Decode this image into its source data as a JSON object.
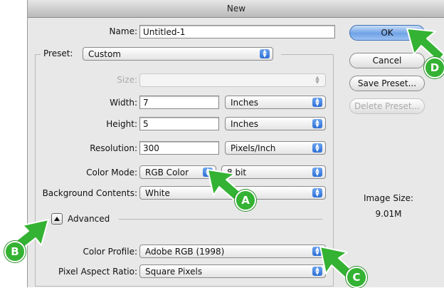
{
  "window": {
    "title": "New"
  },
  "form": {
    "name_label": "Name:",
    "name_value": "Untitled-1",
    "preset_label": "Preset:",
    "preset_value": "Custom",
    "size_label": "Size:",
    "width_label": "Width:",
    "width_value": "7",
    "width_unit": "Inches",
    "height_label": "Height:",
    "height_value": "5",
    "height_unit": "Inches",
    "resolution_label": "Resolution:",
    "resolution_value": "300",
    "resolution_unit": "Pixels/Inch",
    "color_mode_label": "Color Mode:",
    "color_mode_value": "RGB Color",
    "bit_depth_value": "8 bit",
    "background_label": "Background Contents:",
    "background_value": "White",
    "advanced_label": "Advanced",
    "color_profile_label": "Color Profile:",
    "color_profile_value": "Adobe RGB (1998)",
    "pixel_aspect_label": "Pixel Aspect Ratio:",
    "pixel_aspect_value": "Square Pixels"
  },
  "buttons": {
    "ok": "OK",
    "cancel": "Cancel",
    "save_preset": "Save Preset...",
    "delete_preset": "Delete Preset..."
  },
  "image_size": {
    "label": "Image Size:",
    "value": "9.01M"
  },
  "callouts": {
    "a": "A",
    "b": "B",
    "c": "C",
    "d": "D"
  },
  "colors": {
    "callout_green": "#34b233",
    "default_button": "#6fa2e6"
  }
}
